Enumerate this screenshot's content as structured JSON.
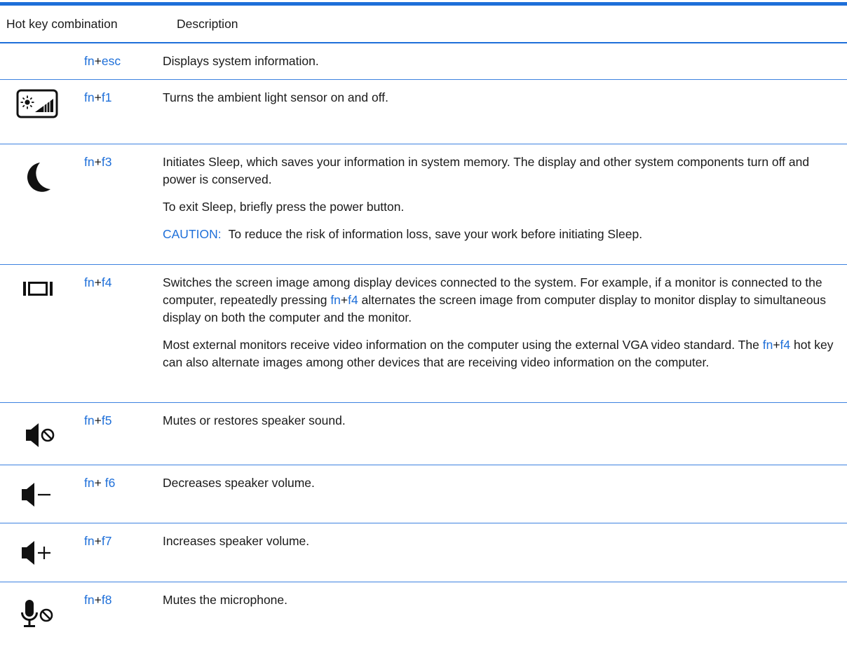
{
  "header": {
    "col_hotkey": "Hot key combination",
    "col_description": "Description"
  },
  "rows": [
    {
      "icon": "none",
      "keys": [
        "fn",
        "esc"
      ],
      "paragraphs": [
        "Displays system information."
      ]
    },
    {
      "icon": "ambient-light-sensor-icon",
      "keys": [
        "fn",
        "f1"
      ],
      "paragraphs": [
        "Turns the ambient light sensor on and off."
      ]
    },
    {
      "icon": "sleep-moon-icon",
      "keys": [
        "fn",
        "f3"
      ],
      "paragraphs": [
        "Initiates Sleep, which saves your information in system memory. The display and other system components turn off and power is conserved.",
        "To exit Sleep, briefly press the power button."
      ],
      "caution_label": "CAUTION:",
      "caution_text": "To reduce the risk of information loss, save your work before initiating Sleep."
    },
    {
      "icon": "switch-display-icon",
      "keys": [
        "fn",
        "f4"
      ],
      "p1_before": "Switches the screen image among display devices connected to the system. For example, if a monitor is connected to the computer, repeatedly pressing ",
      "p1_key1": "fn",
      "p1_plus": "+",
      "p1_key2": "f4",
      "p1_after": " alternates the screen image from computer display to monitor display to simultaneous display on both the computer and the monitor.",
      "p2_before": "Most external monitors receive video information on the computer using the external VGA video standard. The ",
      "p2_key1": "fn",
      "p2_plus": "+",
      "p2_key2": "f4",
      "p2_after": " hot key can also alternate images among other devices that are receiving video information on the computer."
    },
    {
      "icon": "speaker-mute-icon",
      "keys": [
        "fn",
        "f5"
      ],
      "paragraphs": [
        "Mutes or restores speaker sound."
      ]
    },
    {
      "icon": "volume-down-icon",
      "keys": [
        "fn",
        " f6"
      ],
      "paragraphs": [
        "Decreases speaker volume."
      ]
    },
    {
      "icon": "volume-up-icon",
      "keys": [
        "fn",
        "f7"
      ],
      "paragraphs": [
        "Increases speaker volume."
      ]
    },
    {
      "icon": "microphone-mute-icon",
      "keys": [
        "fn",
        "f8"
      ],
      "paragraphs": [
        "Mutes the microphone."
      ]
    }
  ],
  "plus_sign": "+",
  "colors": {
    "accent": "#1e6fd9",
    "text": "#1a1a1a"
  }
}
